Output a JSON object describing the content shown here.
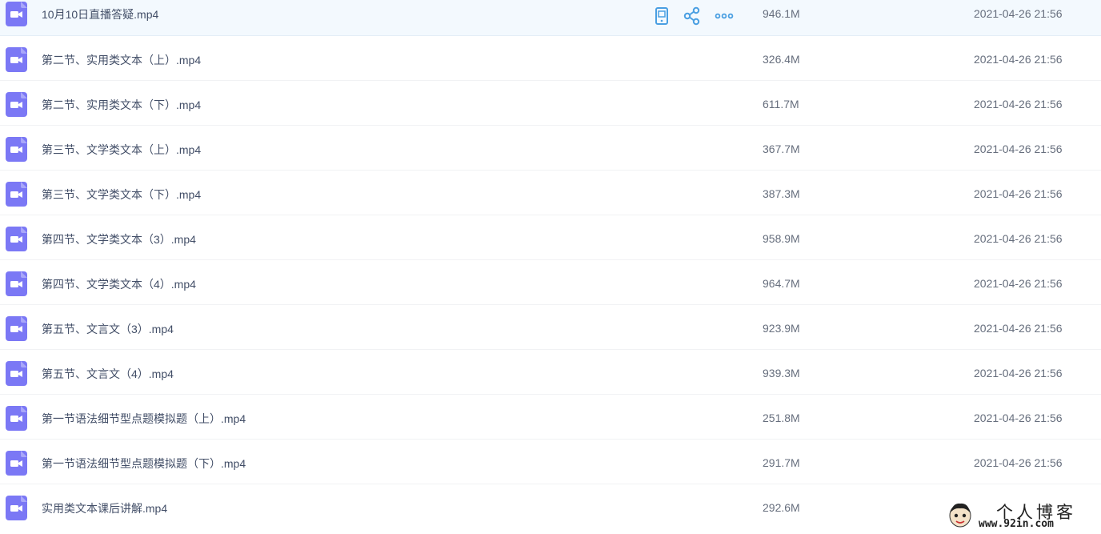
{
  "colors": {
    "file_icon": "#7b78f5",
    "action_icon": "#4a9fe2",
    "selected_row_bg": "#f3f9fe",
    "name_text": "#424e67",
    "meta_text": "#666e7d"
  },
  "file_icon": "video-file-icon",
  "row_actions": {
    "send_to_phone_icon": "phone-icon",
    "share_icon": "share-icon",
    "more_icon": "more-dots-icon"
  },
  "files": [
    {
      "name": "10月10日直播答疑.mp4",
      "size": "946.1M",
      "date": "2021-04-26 21:56"
    },
    {
      "name": "第二节、实用类文本（上）.mp4",
      "size": "326.4M",
      "date": "2021-04-26 21:56"
    },
    {
      "name": "第二节、实用类文本（下）.mp4",
      "size": "611.7M",
      "date": "2021-04-26 21:56"
    },
    {
      "name": "第三节、文学类文本（上）.mp4",
      "size": "367.7M",
      "date": "2021-04-26 21:56"
    },
    {
      "name": "第三节、文学类文本（下）.mp4",
      "size": "387.3M",
      "date": "2021-04-26 21:56"
    },
    {
      "name": "第四节、文学类文本（3）.mp4",
      "size": "958.9M",
      "date": "2021-04-26 21:56"
    },
    {
      "name": "第四节、文学类文本（4）.mp4",
      "size": "964.7M",
      "date": "2021-04-26 21:56"
    },
    {
      "name": "第五节、文言文（3）.mp4",
      "size": "923.9M",
      "date": "2021-04-26 21:56"
    },
    {
      "name": "第五节、文言文（4）.mp4",
      "size": "939.3M",
      "date": "2021-04-26 21:56"
    },
    {
      "name": "第一节语法细节型点题模拟题（上）.mp4",
      "size": "251.8M",
      "date": "2021-04-26 21:56"
    },
    {
      "name": "第一节语法细节型点题模拟题（下）.mp4",
      "size": "291.7M",
      "date": "2021-04-26 21:56"
    },
    {
      "name": "实用类文本课后讲解.mp4",
      "size": "292.6M",
      "date": ""
    }
  ],
  "watermark": {
    "title": "个人博客",
    "url": "www.92in.com"
  }
}
